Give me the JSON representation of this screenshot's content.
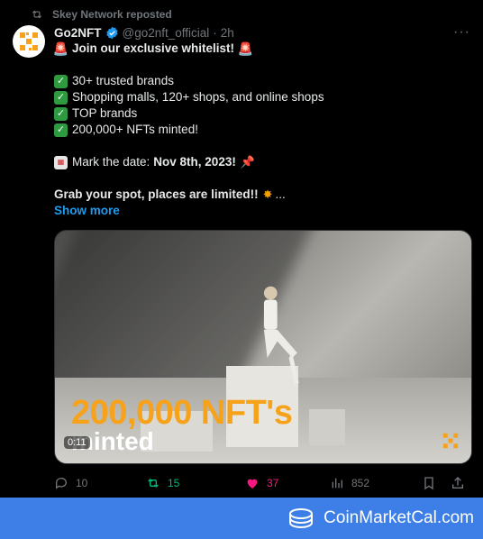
{
  "repost": {
    "label": "Skey Network reposted"
  },
  "tweet": {
    "author_name": "Go2NFT",
    "handle": "@go2nft_official",
    "separator": "·",
    "time": "2h",
    "more": "···",
    "title": "Join our exclusive whitelist!",
    "bullets": [
      "30+ trusted brands",
      "Shopping malls, 120+ shops, and online shops",
      "TOP brands",
      "200,000+ NFTs minted!"
    ],
    "date_prefix": "Mark the date:",
    "date_value": "Nov 8th, 2023!",
    "grab": "Grab your spot, places are limited!!",
    "ellipsis": "...",
    "show_more": "Show more"
  },
  "media": {
    "headline": "200,000 NFT's",
    "headline2": "minted",
    "duration": "0:11"
  },
  "actions": {
    "replies": "10",
    "reposts": "15",
    "likes": "37",
    "views": "852"
  },
  "colors": {
    "accent": "#1d9bf0",
    "repost_green": "#00ba7c",
    "like_pink": "#f91880",
    "brand_orange": "#f7a21b",
    "banner_blue": "#3d7fe6"
  },
  "banner": {
    "brand": "CoinMarketCal.com"
  }
}
